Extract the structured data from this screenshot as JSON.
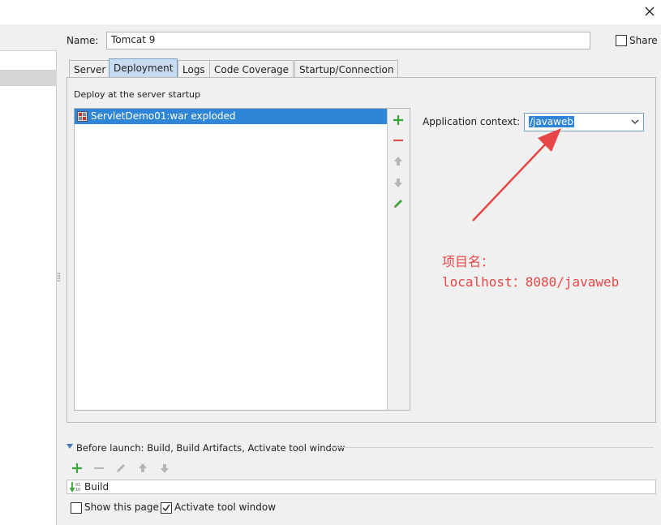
{
  "dialog": {
    "close_icon": "close-icon"
  },
  "name_row": {
    "label": "Name:",
    "value": "Tomcat 9",
    "share_label": "Share",
    "share_checked": false
  },
  "tabs": [
    {
      "label": "Server",
      "active": false
    },
    {
      "label": "Deployment",
      "active": true
    },
    {
      "label": "Logs",
      "active": false
    },
    {
      "label": "Code Coverage",
      "active": false
    },
    {
      "label": "Startup/Connection",
      "active": false
    }
  ],
  "deployment": {
    "section_label": "Deploy at the server startup",
    "items": [
      {
        "label": "ServletDemo01:war exploded",
        "icon": "war-artifact-icon",
        "selected": true
      }
    ],
    "toolbar": [
      "add-icon",
      "remove-icon",
      "move-up-icon",
      "move-down-icon",
      "edit-icon"
    ],
    "app_context_label": "Application context:",
    "app_context_value": "/javaweb"
  },
  "annotation": {
    "line1": "项目名：",
    "line2": "localhost：8080/javaweb",
    "color": "#e64646"
  },
  "before_launch": {
    "title": "Before launch: Build, Build Artifacts, Activate tool window",
    "toolbar": [
      "add-icon",
      "remove-icon",
      "edit-icon",
      "move-up-icon",
      "move-down-icon"
    ],
    "tasks": [
      {
        "label": "Build",
        "icon": "build-icon"
      }
    ],
    "show_page_label": "Show this page",
    "show_page_checked": false,
    "activate_label": "Activate tool window",
    "activate_checked": true
  },
  "colors": {
    "selection": "#2f86d6",
    "active_tab": "#c7dcf0",
    "add_green": "#3aa53a",
    "remove_red": "#d9534f"
  }
}
